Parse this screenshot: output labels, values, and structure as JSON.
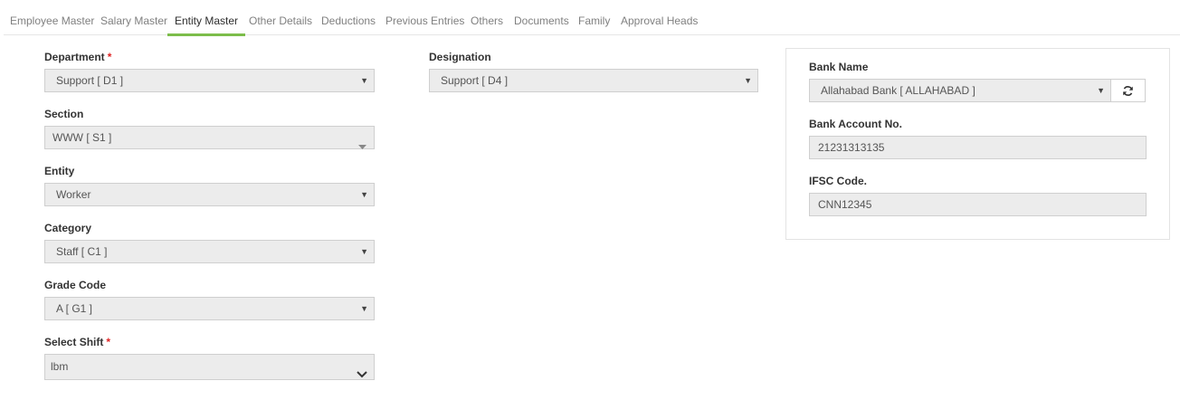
{
  "tabs": [
    {
      "label": "Employee Master"
    },
    {
      "label": "Salary Master"
    },
    {
      "label": "Entity Master"
    },
    {
      "label": "Other Details"
    },
    {
      "label": "Deductions"
    },
    {
      "label": "Previous Entries"
    },
    {
      "label": "Others"
    },
    {
      "label": "Documents"
    },
    {
      "label": "Family"
    },
    {
      "label": "Approval Heads"
    }
  ],
  "active_tab": "Entity Master",
  "accent_color": "#7cbd4a",
  "required_marker": "*",
  "form": {
    "department": {
      "label": "Department",
      "value": "Support [ D1 ]",
      "required": true
    },
    "section": {
      "label": "Section",
      "value": "WWW [ S1 ]"
    },
    "entity": {
      "label": "Entity",
      "value": "Worker"
    },
    "category": {
      "label": "Category",
      "value": "Staff [ C1 ]"
    },
    "grade_code": {
      "label": "Grade Code",
      "value": "A [ G1 ]"
    },
    "select_shift": {
      "label": "Select Shift",
      "value": "lbm",
      "required": true
    },
    "designation": {
      "label": "Designation",
      "value": "Support [ D4 ]"
    }
  },
  "bank": {
    "bank_name": {
      "label": "Bank Name",
      "value": "Allahabad Bank [ ALLAHABAD ]",
      "refresh_icon": "refresh-icon"
    },
    "account_no": {
      "label": "Bank Account No.",
      "value": "21231313135"
    },
    "ifsc": {
      "label": "IFSC Code.",
      "value": "CNN12345"
    }
  },
  "icons": {
    "caret": "▼"
  }
}
